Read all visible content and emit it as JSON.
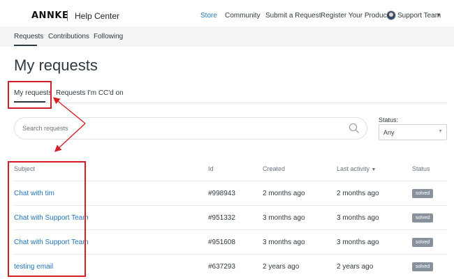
{
  "header": {
    "logo_text": "ANNKE",
    "site_title": "Help Center",
    "nav": [
      "Store",
      "Community",
      "Submit a Request",
      "Register Your Products"
    ],
    "user_name": "Support Team"
  },
  "subnav": {
    "items": [
      "Requests",
      "Contributions",
      "Following"
    ],
    "active": "Requests"
  },
  "page_title": "My requests",
  "tabs": {
    "items": [
      "My requests",
      "Requests I'm CC'd on"
    ],
    "active": "My requests"
  },
  "search": {
    "placeholder": "Search requests"
  },
  "status_filter": {
    "label": "Status:",
    "value": "Any"
  },
  "table": {
    "headers": {
      "subject": "Subject",
      "id": "Id",
      "created": "Created",
      "last_activity": "Last activity",
      "status": "Status"
    },
    "sort_indicator": "▼",
    "rows": [
      {
        "subject": "Chat with tim",
        "id": "#998943",
        "created": "2 months ago",
        "last_activity": "2 months ago",
        "status": "solved"
      },
      {
        "subject": "Chat with Support Team",
        "id": "#951332",
        "created": "3 months ago",
        "last_activity": "3 months ago",
        "status": "solved"
      },
      {
        "subject": "Chat with Support Team",
        "id": "#951608",
        "created": "3 months ago",
        "last_activity": "3 months ago",
        "status": "solved"
      },
      {
        "subject": "testing email",
        "id": "#637293",
        "created": "2 years ago",
        "last_activity": "2 years ago",
        "status": "solved"
      }
    ]
  },
  "colors": {
    "link": "#1f73b7",
    "annotation": "#d51f26",
    "badge": "#87929d",
    "text": "#2f3941"
  },
  "icons": [
    "search-icon",
    "chevron-down-icon",
    "avatar",
    "sort-down-icon"
  ]
}
